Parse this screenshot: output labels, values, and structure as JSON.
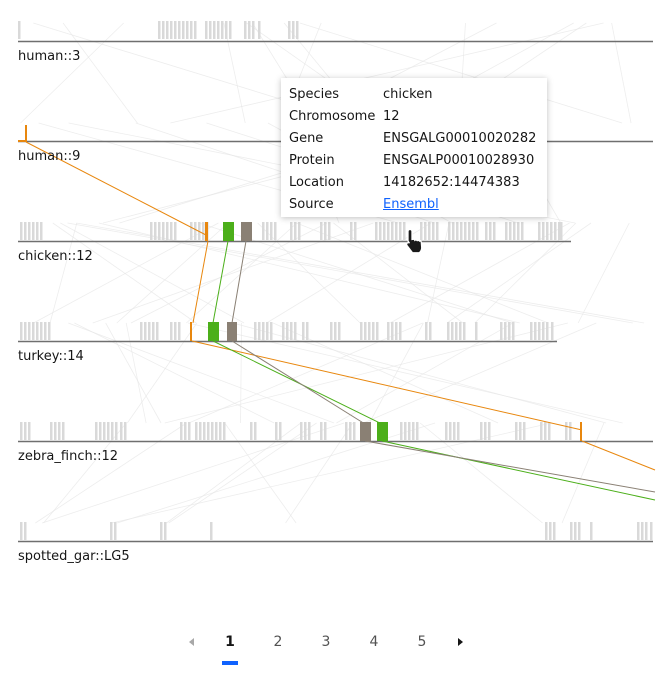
{
  "tracks": [
    {
      "label": "human::3"
    },
    {
      "label": "human::9"
    },
    {
      "label": "chicken::12"
    },
    {
      "label": "turkey::14"
    },
    {
      "label": "zebra_finch::12"
    },
    {
      "label": "spotted_gar::LG5"
    }
  ],
  "tooltip": {
    "rows": [
      {
        "key": "Species",
        "value": "chicken"
      },
      {
        "key": "Chromosome",
        "value": "12"
      },
      {
        "key": "Gene",
        "value": "ENSGALG00010020282"
      },
      {
        "key": "Protein",
        "value": "ENSGALP00010028930"
      },
      {
        "key": "Location",
        "value": "14182652:14474383"
      },
      {
        "key": "Source",
        "value": "Ensembl"
      }
    ]
  },
  "pagination": {
    "pages": [
      "1",
      "2",
      "3",
      "4",
      "5"
    ],
    "current": "1",
    "prev_icon": "caret-left-icon",
    "next_icon": "caret-right-icon"
  },
  "colors": {
    "orange": "#e8870e",
    "green": "#4caf1a",
    "taupe": "#8a8074",
    "track_line": "#6f6f6f",
    "gene_tick": "#d9d9d9",
    "link": "#0f62fe"
  }
}
